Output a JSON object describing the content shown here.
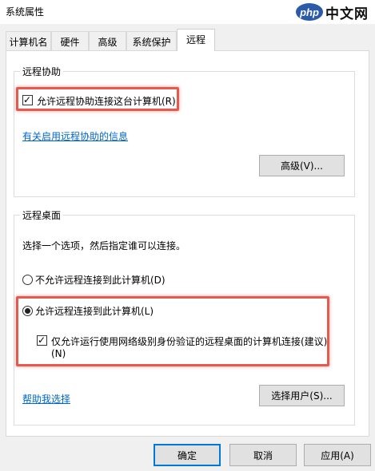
{
  "window": {
    "title": "系统属性"
  },
  "watermark": {
    "badge": "php",
    "text": "中文网"
  },
  "tabs": [
    {
      "label": "计算机名"
    },
    {
      "label": "硬件"
    },
    {
      "label": "高级"
    },
    {
      "label": "系统保护"
    },
    {
      "label": "远程",
      "active": true
    }
  ],
  "remote_assistance": {
    "title": "远程协助",
    "allow_label": "允许远程协助连接这台计算机(R)",
    "allow_checked": true,
    "info_link": "有关启用远程协助的信息",
    "advanced_button": "高级(V)..."
  },
  "remote_desktop": {
    "title": "远程桌面",
    "instruction": "选择一个选项，然后指定谁可以连接。",
    "option_deny": "不允许远程连接到此计算机(D)",
    "option_allow": "允许远程连接到此计算机(L)",
    "selected": "allow",
    "nla_label_line1": "仅允许运行使用网络级别身份验证的远程桌面的计算机连接(建议)",
    "nla_label_line2": "(N)",
    "nla_checked": true,
    "help_link": "帮助我选择",
    "select_users_button": "选择用户(S)..."
  },
  "footer": {
    "ok": "确定",
    "cancel": "取消",
    "apply": "应用(A)"
  },
  "colors": {
    "highlight": "#e55a4f",
    "link": "#0066cc",
    "focus": "#0078d7"
  }
}
